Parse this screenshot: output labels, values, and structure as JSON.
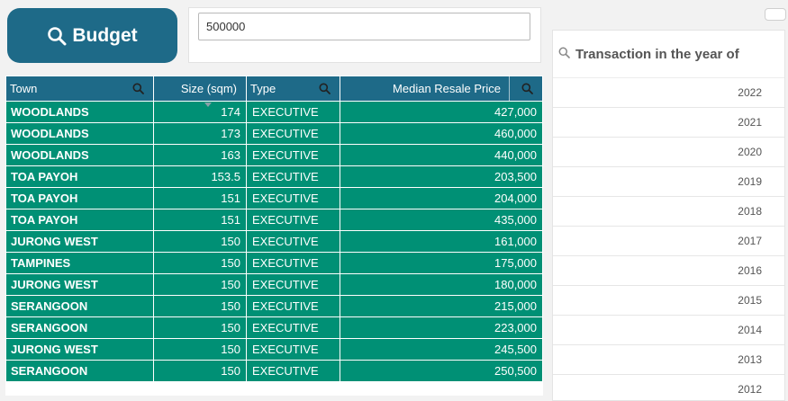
{
  "budget_button": {
    "label": "Budget",
    "icon": "search-icon"
  },
  "budget_input": {
    "value": "500000"
  },
  "table": {
    "headers": {
      "town": "Town",
      "size": "Size (sqm)",
      "type": "Type",
      "price": "Median Resale Price"
    },
    "rows": [
      {
        "town": "WOODLANDS",
        "size": "174",
        "type": "EXECUTIVE",
        "price": "427,000"
      },
      {
        "town": "WOODLANDS",
        "size": "173",
        "type": "EXECUTIVE",
        "price": "460,000"
      },
      {
        "town": "WOODLANDS",
        "size": "163",
        "type": "EXECUTIVE",
        "price": "440,000"
      },
      {
        "town": "TOA PAYOH",
        "size": "153.5",
        "type": "EXECUTIVE",
        "price": "203,500"
      },
      {
        "town": "TOA PAYOH",
        "size": "151",
        "type": "EXECUTIVE",
        "price": "204,000"
      },
      {
        "town": "TOA PAYOH",
        "size": "151",
        "type": "EXECUTIVE",
        "price": "435,000"
      },
      {
        "town": "JURONG WEST",
        "size": "150",
        "type": "EXECUTIVE",
        "price": "161,000"
      },
      {
        "town": "TAMPINES",
        "size": "150",
        "type": "EXECUTIVE",
        "price": "175,000"
      },
      {
        "town": "JURONG WEST",
        "size": "150",
        "type": "EXECUTIVE",
        "price": "180,000"
      },
      {
        "town": "SERANGOON",
        "size": "150",
        "type": "EXECUTIVE",
        "price": "215,000"
      },
      {
        "town": "SERANGOON",
        "size": "150",
        "type": "EXECUTIVE",
        "price": "223,000"
      },
      {
        "town": "JURONG WEST",
        "size": "150",
        "type": "EXECUTIVE",
        "price": "245,500"
      },
      {
        "town": "SERANGOON",
        "size": "150",
        "type": "EXECUTIVE",
        "price": "250,500"
      }
    ]
  },
  "year_filter": {
    "title": "Transaction in the year of",
    "years": [
      "2022",
      "2021",
      "2020",
      "2019",
      "2018",
      "2017",
      "2016",
      "2015",
      "2014",
      "2013",
      "2012"
    ]
  },
  "colors": {
    "header_bg": "#1e6a88",
    "row_bg": "#009075",
    "button_bg": "#1e6a88"
  }
}
